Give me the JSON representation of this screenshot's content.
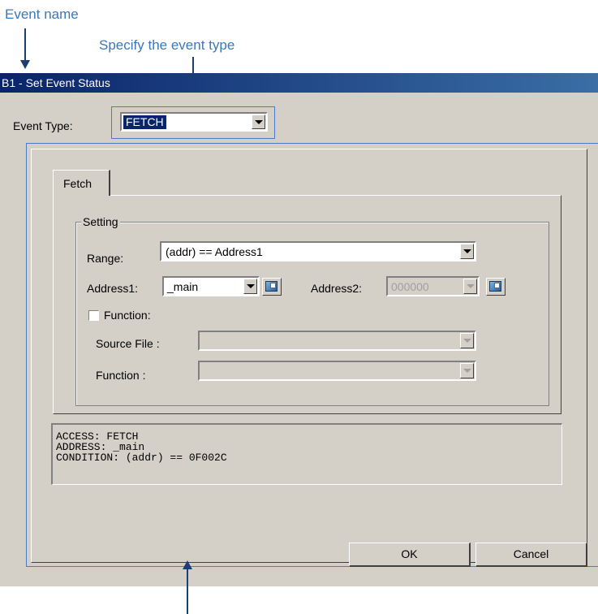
{
  "annotations": {
    "event_name": "Event name",
    "event_type": "Specify the event type"
  },
  "window": {
    "title": "B1 - Set Event Status"
  },
  "event_type": {
    "label": "Event Type:",
    "value": "FETCH"
  },
  "tab": {
    "label": "Fetch"
  },
  "setting": {
    "group_label": "Setting",
    "range_label": "Range:",
    "range_value": "(addr) == Address1",
    "address1_label": "Address1:",
    "address1_value": "_main",
    "address2_label": "Address2:",
    "address2_value": "000000",
    "function_checkbox_label": "Function:",
    "function_checked": false,
    "source_file_label": "Source File :",
    "source_file_value": "",
    "function_label": "Function :",
    "function_value": ""
  },
  "status": {
    "lines": [
      "ACCESS: FETCH",
      "ADDRESS: _main",
      "CONDITION: (addr) == 0F002C"
    ]
  },
  "buttons": {
    "ok": "OK",
    "cancel": "Cancel"
  },
  "colors": {
    "titlebar": "#0a246a",
    "annotation": "#3a78b8",
    "dialog_bg": "#d4d0c8",
    "highlight": "#4a7ac8"
  }
}
